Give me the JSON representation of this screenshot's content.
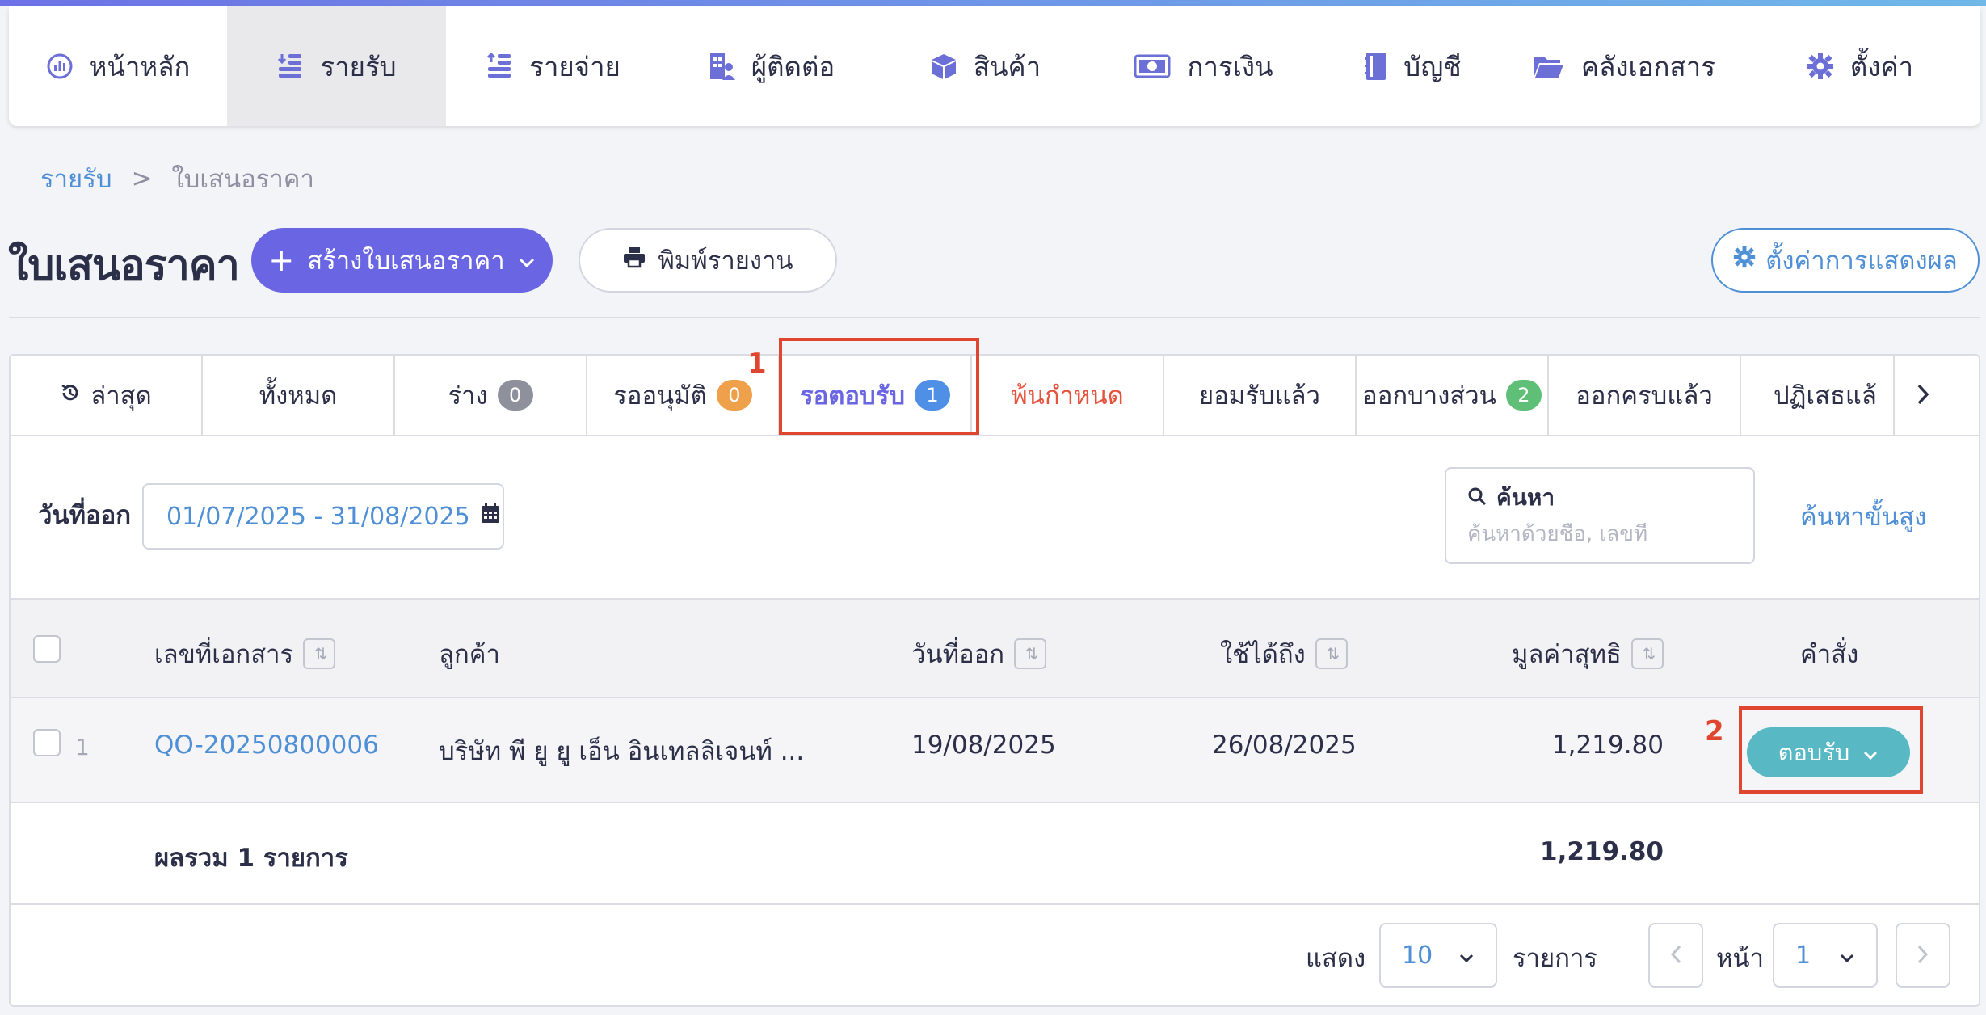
{
  "nav": {
    "items": [
      {
        "label": "หน้าหลัก",
        "icon": "dashboard-icon"
      },
      {
        "label": "รายรับ",
        "icon": "income-icon",
        "active": true
      },
      {
        "label": "รายจ่าย",
        "icon": "expense-icon"
      },
      {
        "label": "ผู้ติดต่อ",
        "icon": "contacts-icon"
      },
      {
        "label": "สินค้า",
        "icon": "box-icon"
      },
      {
        "label": "การเงิน",
        "icon": "money-icon"
      },
      {
        "label": "บัญชี",
        "icon": "ledger-icon"
      },
      {
        "label": "คลังเอกสาร",
        "icon": "folder-icon"
      },
      {
        "label": "ตั้งค่า",
        "icon": "gear-icon"
      }
    ]
  },
  "breadcrumb": {
    "parent": "รายรับ",
    "separator": ">",
    "current": "ใบเสนอราคา"
  },
  "header": {
    "title": "ใบเสนอราคา",
    "create_label": "สร้างใบเสนอราคา",
    "print_label": "พิมพ์รายงาน",
    "display_settings_label": "ตั้งค่าการแสดงผล"
  },
  "tabs": [
    {
      "label": "ล่าสุด"
    },
    {
      "label": "ทั้งหมด"
    },
    {
      "label": "ร่าง",
      "badge": "0",
      "badge_color": "#8e909c"
    },
    {
      "label": "รออนุมัติ",
      "badge": "0",
      "badge_color": "#eea04a"
    },
    {
      "label": "รอตอบรับ",
      "badge": "1",
      "badge_color": "#4f8fe6",
      "active": true
    },
    {
      "label": "พ้นกำหนด",
      "color": "#e5533c"
    },
    {
      "label": "ยอมรับแล้ว"
    },
    {
      "label": "ออกบางส่วน",
      "badge": "2",
      "badge_color": "#5fbf77"
    },
    {
      "label": "ออกครบแล้ว"
    },
    {
      "label": "ปฏิเสธแล้"
    }
  ],
  "annotations": {
    "step1": "1",
    "step2": "2"
  },
  "filters": {
    "date_label": "วันที่ออก",
    "date_range": "01/07/2025 - 31/08/2025",
    "search_label": "ค้นหา",
    "search_placeholder": "ค้นหาด้วยชื่อ, เลขที่",
    "advanced_search": "ค้นหาขั้นสูง"
  },
  "table": {
    "columns": {
      "doc_no": "เลขที่เอกสาร",
      "customer": "ลูกค้า",
      "issue_date": "วันที่ออก",
      "valid_until": "ใช้ได้ถึง",
      "net_value": "มูลค่าสุทธิ",
      "action": "คำสั่ง"
    },
    "rows": [
      {
        "index": "1",
        "doc_no": "QO-20250800006",
        "customer": "บริษัท พี ยู ยู เอ็น อินเทลลิเจนท์ ...",
        "issue_date": "19/08/2025",
        "valid_until": "26/08/2025",
        "net_value": "1,219.80",
        "action": "ตอบรับ"
      }
    ],
    "total_label": "ผลรวม 1 รายการ",
    "total_value": "1,219.80"
  },
  "pagination": {
    "show_label": "แสดง",
    "page_size": "10",
    "items_label": "รายการ",
    "page_label": "หน้า",
    "page": "1"
  },
  "colors": {
    "primary": "#6a66e3",
    "link": "#4f8fd6",
    "accept": "#58b9c4",
    "annotation": "#e0462f"
  }
}
